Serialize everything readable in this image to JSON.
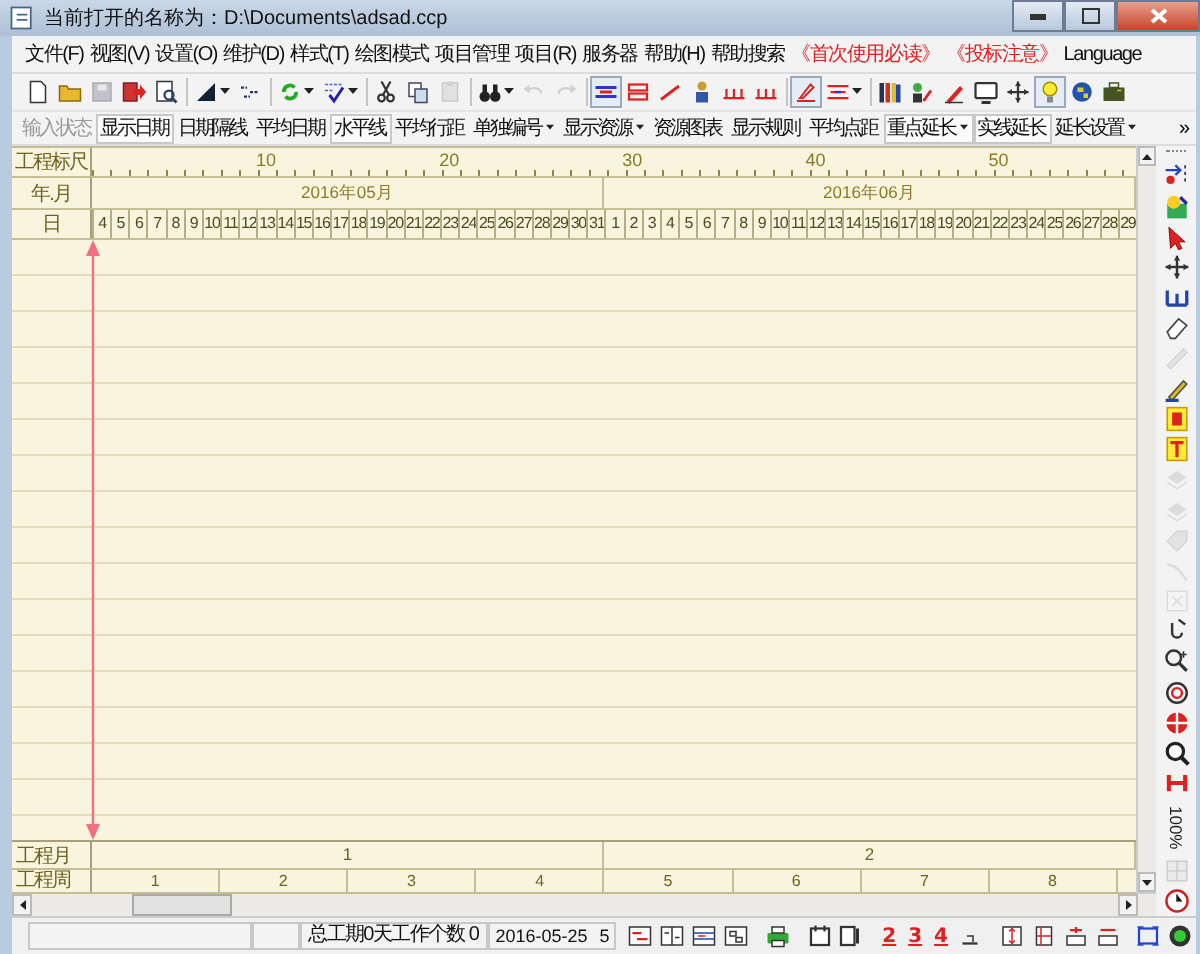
{
  "window": {
    "title": "当前打开的名称为：D:\\Documents\\adsad.ccp"
  },
  "menu": [
    {
      "label": "文件(F)",
      "kind": "normal"
    },
    {
      "label": "视图(V)",
      "kind": "normal"
    },
    {
      "label": "设置(O)",
      "kind": "normal"
    },
    {
      "label": "维护(D)",
      "kind": "normal"
    },
    {
      "label": "样式(T)",
      "kind": "normal"
    },
    {
      "label": "绘图模式",
      "kind": "normal"
    },
    {
      "label": "项目管理",
      "kind": "normal"
    },
    {
      "label": "项目(R)",
      "kind": "normal"
    },
    {
      "label": "服务器",
      "kind": "normal"
    },
    {
      "label": "帮助(H)",
      "kind": "normal"
    },
    {
      "label": "帮助搜索",
      "kind": "normal"
    },
    {
      "label": "《首次使用必读》",
      "kind": "notice"
    },
    {
      "label": "《投标注意》",
      "kind": "notice"
    },
    {
      "label": "Language",
      "kind": "normal"
    }
  ],
  "toolbar": [
    {
      "kind": "button",
      "disabled": false,
      "pressed": false,
      "dropdown": false
    },
    {
      "kind": "button",
      "disabled": false,
      "pressed": false,
      "dropdown": false
    },
    {
      "kind": "button",
      "disabled": true,
      "pressed": false,
      "dropdown": false
    },
    {
      "kind": "button",
      "disabled": false,
      "pressed": false,
      "dropdown": false
    },
    {
      "kind": "button",
      "disabled": false,
      "pressed": false,
      "dropdown": false
    },
    {
      "kind": "separator"
    },
    {
      "kind": "button",
      "disabled": false,
      "pressed": false,
      "dropdown": true
    },
    {
      "kind": "button",
      "disabled": false,
      "pressed": false,
      "dropdown": false
    },
    {
      "kind": "separator"
    },
    {
      "kind": "button",
      "disabled": false,
      "pressed": false,
      "dropdown": true
    },
    {
      "kind": "button",
      "disabled": false,
      "pressed": false,
      "dropdown": true
    },
    {
      "kind": "separator"
    },
    {
      "kind": "button",
      "disabled": false,
      "pressed": false,
      "dropdown": false
    },
    {
      "kind": "button",
      "disabled": false,
      "pressed": false,
      "dropdown": false
    },
    {
      "kind": "button",
      "disabled": true,
      "pressed": false,
      "dropdown": false
    },
    {
      "kind": "separator"
    },
    {
      "kind": "button",
      "disabled": false,
      "pressed": false,
      "dropdown": true
    },
    {
      "kind": "button",
      "disabled": true,
      "pressed": false,
      "dropdown": false
    },
    {
      "kind": "button",
      "disabled": true,
      "pressed": false,
      "dropdown": false
    },
    {
      "kind": "separator"
    },
    {
      "kind": "button",
      "disabled": false,
      "pressed": true,
      "dropdown": false
    },
    {
      "kind": "button",
      "disabled": false,
      "pressed": false,
      "dropdown": false
    },
    {
      "kind": "button",
      "disabled": false,
      "pressed": false,
      "dropdown": false
    },
    {
      "kind": "button",
      "disabled": false,
      "pressed": false,
      "dropdown": false
    },
    {
      "kind": "button",
      "disabled": false,
      "pressed": false,
      "dropdown": false
    },
    {
      "kind": "button",
      "disabled": false,
      "pressed": false,
      "dropdown": false
    },
    {
      "kind": "separator"
    },
    {
      "kind": "button",
      "disabled": false,
      "pressed": true,
      "dropdown": false
    },
    {
      "kind": "button",
      "disabled": false,
      "pressed": false,
      "dropdown": true
    },
    {
      "kind": "separator"
    },
    {
      "kind": "button",
      "disabled": false,
      "pressed": false,
      "dropdown": false
    },
    {
      "kind": "button",
      "disabled": false,
      "pressed": false,
      "dropdown": false
    },
    {
      "kind": "button",
      "disabled": false,
      "pressed": false,
      "dropdown": false
    },
    {
      "kind": "button",
      "disabled": false,
      "pressed": false,
      "dropdown": false
    },
    {
      "kind": "button",
      "disabled": false,
      "pressed": false,
      "dropdown": false
    },
    {
      "kind": "button",
      "disabled": false,
      "pressed": true,
      "dropdown": false
    },
    {
      "kind": "button",
      "disabled": false,
      "pressed": false,
      "dropdown": false
    },
    {
      "kind": "button",
      "disabled": false,
      "pressed": false,
      "dropdown": false
    }
  ],
  "format_bar": {
    "items": [
      {
        "label": "输入状态",
        "disabled": true,
        "pressed": false,
        "dropdown": false
      },
      {
        "label": "显示日期",
        "disabled": false,
        "pressed": true,
        "dropdown": false
      },
      {
        "label": "日期隔线",
        "disabled": false,
        "pressed": false,
        "dropdown": false
      },
      {
        "label": "平均日期",
        "disabled": false,
        "pressed": false,
        "dropdown": false
      },
      {
        "label": "水平线",
        "disabled": false,
        "pressed": true,
        "dropdown": false
      },
      {
        "label": "平均行距",
        "disabled": false,
        "pressed": false,
        "dropdown": false
      },
      {
        "label": "单独编号",
        "disabled": false,
        "pressed": false,
        "dropdown": true
      },
      {
        "label": "显示资源",
        "disabled": false,
        "pressed": false,
        "dropdown": true
      },
      {
        "label": "资源图表",
        "disabled": false,
        "pressed": false,
        "dropdown": false
      },
      {
        "label": "显示规则",
        "disabled": false,
        "pressed": false,
        "dropdown": false
      },
      {
        "label": "平均点距",
        "disabled": false,
        "pressed": false,
        "dropdown": false
      },
      {
        "label": "重点延长",
        "disabled": false,
        "pressed": true,
        "dropdown": true
      },
      {
        "label": "实线延长",
        "disabled": false,
        "pressed": true,
        "dropdown": false
      },
      {
        "label": "延长设置",
        "disabled": false,
        "pressed": false,
        "dropdown": true
      }
    ],
    "overflow": "»"
  },
  "chart": {
    "ruler_label": "工程标尺",
    "ruler_ticks": [
      "10",
      "20",
      "30",
      "40",
      "50"
    ],
    "month_label": "年.月",
    "day_label": "日",
    "months": [
      {
        "label": "2016年05月",
        "days": [
          "4",
          "5",
          "6",
          "7",
          "8",
          "9",
          "10",
          "11",
          "12",
          "13",
          "14",
          "15",
          "16",
          "17",
          "18",
          "19",
          "20",
          "21",
          "22",
          "23",
          "24",
          "25",
          "26",
          "27",
          "28",
          "29",
          "30",
          "31"
        ]
      },
      {
        "label": "2016年06月",
        "days": [
          "1",
          "2",
          "3",
          "4",
          "5",
          "6",
          "7",
          "8",
          "9",
          "10",
          "11",
          "12",
          "13",
          "14",
          "15",
          "16",
          "17",
          "18",
          "19",
          "20",
          "21",
          "22",
          "23",
          "24",
          "25",
          "26",
          "27",
          "28",
          "29"
        ]
      }
    ],
    "project_month_label": "工程月",
    "project_months": [
      "1",
      "2"
    ],
    "project_week_label": "工程周",
    "project_weeks": [
      "1",
      "2",
      "3",
      "4",
      "5",
      "6",
      "7",
      "8"
    ]
  },
  "side_toolbar": {
    "tools": [
      {
        "disabled": false
      },
      {
        "disabled": false
      },
      {
        "disabled": false
      },
      {
        "disabled": false
      },
      {
        "disabled": false
      },
      {
        "disabled": false
      },
      {
        "disabled": true
      },
      {
        "disabled": false
      },
      {
        "disabled": false
      },
      {
        "disabled": false
      },
      {
        "disabled": true
      },
      {
        "disabled": true
      },
      {
        "disabled": true
      },
      {
        "disabled": true
      },
      {
        "disabled": true
      },
      {
        "disabled": false
      },
      {
        "disabled": false
      },
      {
        "disabled": false
      },
      {
        "disabled": false
      },
      {
        "disabled": false
      },
      {
        "disabled": false
      }
    ],
    "zoom": "100%"
  },
  "status_bar": {
    "summary": "总工期0天工作个数 0",
    "date": "2016-05-25",
    "count": "5",
    "level_buttons": [
      "2",
      "3",
      "4"
    ]
  }
}
